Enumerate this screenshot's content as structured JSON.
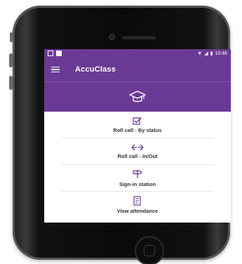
{
  "status_bar": {
    "time": "10:46"
  },
  "app_bar": {
    "title": "AccuClass",
    "menu_icon": "hamburger-icon"
  },
  "hero": {
    "icon": "graduation-cap-icon"
  },
  "menu": {
    "items": [
      {
        "label": "Roll call - By status",
        "icon": "checkbox-icon"
      },
      {
        "label": "Roll call - In/Out",
        "icon": "arrows-icon"
      },
      {
        "label": "Sign-in station",
        "icon": "signpost-icon"
      },
      {
        "label": "View attendance",
        "icon": "list-icon"
      }
    ]
  },
  "colors": {
    "primary": "#6b3a96",
    "icon": "#6b3a96",
    "text": "#333333",
    "device_body": "#111111"
  }
}
